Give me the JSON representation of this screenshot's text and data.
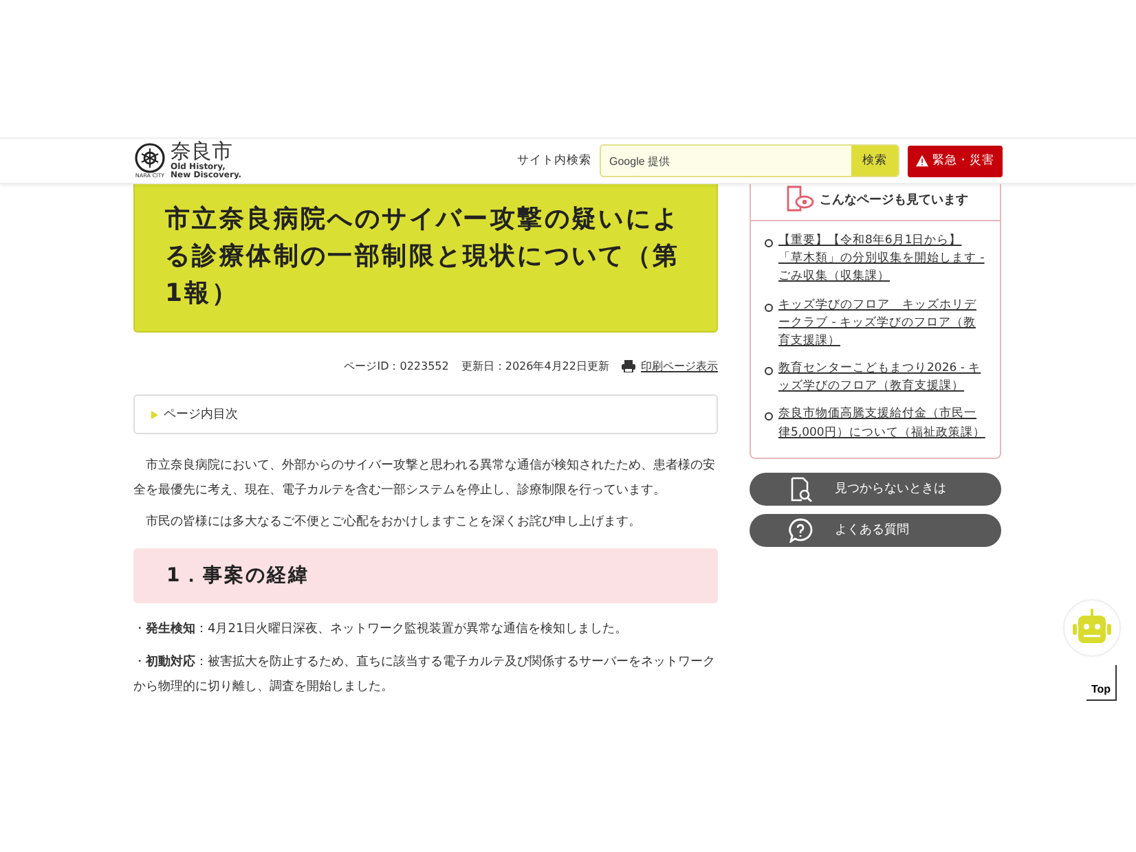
{
  "header": {
    "logo_name": "奈良市",
    "logo_sub": "NARA CITY",
    "tagline_1": "Old History,",
    "tagline_2": "New Discovery.",
    "search_label": "サイト内検索",
    "search_placeholder": "Google 提供",
    "search_button": "検索",
    "emergency_button": "緊急・災害"
  },
  "article": {
    "title": "市立奈良病院へのサイバー攻撃の疑いによる診療体制の一部制限と現状について（第1報）",
    "page_id": "ページID：0223552",
    "updated": "更新日：2026年4月22日更新",
    "print_link": "印刷ページ表示",
    "toc_label": "ページ内目次",
    "paragraphs": [
      "市立奈良病院において、外部からのサイバー攻撃と思われる異常な通信が検知されたため、患者様の安全を最優先に考え、現在、電子カルテを含む一部システムを停止し、診療制限を行っています。",
      "市民の皆様には多大なるご不便とご心配をおかけしますことを深くお詫び申し上げます。"
    ],
    "section_heading": "1．事案の経緯",
    "bullets": [
      "・**発生検知**：4月21日火曜日深夜、ネットワーク監視装置が異常な通信を検知しました。",
      "・**初動対応**：被害拡大を防止するため、直ちに該当する電子カルテ及び関係するサーバーをネットワークから物理的に切り離し、調査を開始しました。"
    ]
  },
  "sidebar": {
    "related_heading": "こんなページも見ています",
    "related_links": [
      "【重要】【令和8年6月1日から】「草木類」の分別収集を開始します - ごみ収集（収集課）",
      "キッズ学びのフロア　キッズホリデークラブ - キッズ学びのフロア（教育支援課）",
      "教育センターこどもまつり2026 - キッズ学びのフロア（教育支援課）",
      "奈良市物価高騰支援給付金（市民一律5,000円）について（福祉政策課）"
    ],
    "buttons": [
      {
        "kind": "search-doc",
        "label": "見つからないときは"
      },
      {
        "kind": "faq",
        "label": "よくある質問"
      }
    ]
  },
  "top_button": "Top"
}
